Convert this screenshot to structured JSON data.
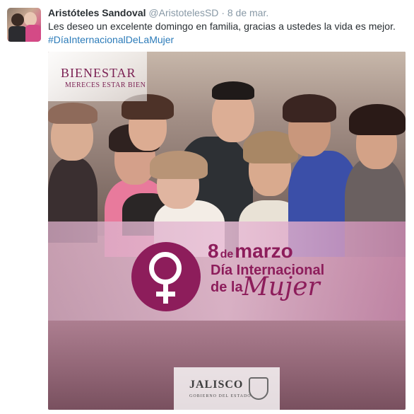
{
  "tweet": {
    "author_name": "Aristóteles Sandoval",
    "author_handle": "@AristotelesSD",
    "separator": "·",
    "date": "8 de mar.",
    "text": "Les deseo un excelente domingo en familia, gracias a ustedes la vida es mejor.",
    "hashtag": "#DíaInternacionalDeLaMujer"
  },
  "media": {
    "brand_logo": {
      "title": "BIENESTAR",
      "subtitle": "MERECES ESTAR BIEN"
    },
    "banner": {
      "number": "8",
      "connector": "de",
      "month": "marzo",
      "line1": "Día Internacional",
      "line2": "de la",
      "line3": "Mujer"
    },
    "government_logo": {
      "title": "JALISCO",
      "subtitle": "GOBIERNO DEL ESTADO"
    },
    "icons": {
      "venus": "venus-icon",
      "crest": "crest-icon"
    }
  },
  "colors": {
    "name": "#292f33",
    "meta": "#8899a6",
    "link": "#2b7bb9",
    "accent": "#8d1d5b"
  }
}
